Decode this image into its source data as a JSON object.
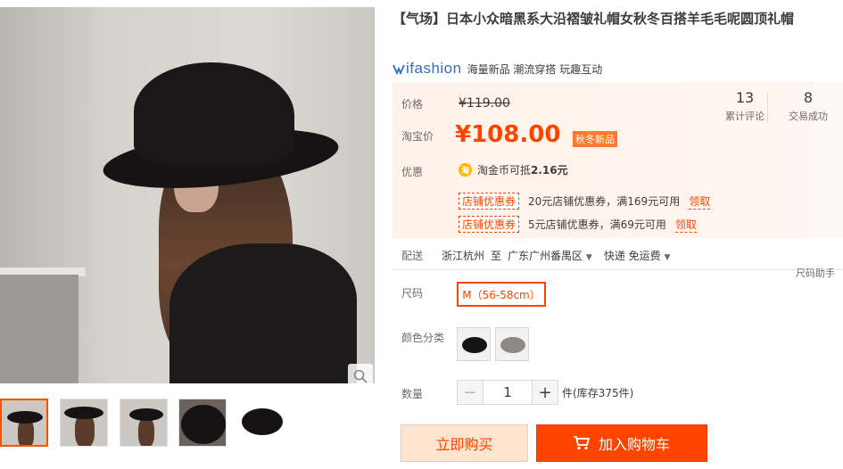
{
  "product": {
    "title": "【气场】日本小众暗黑系大沿褶皱礼帽女秋冬百搭羊毛毛呢圆顶礼帽"
  },
  "brand": {
    "logo_text": "ifashion",
    "tags": "海量新品 潮流穿搭 玩趣互动"
  },
  "price": {
    "label": "价格",
    "original": "¥119.00",
    "taobao_label": "淘宝价",
    "current": "¥108.00",
    "promo_tag": "秋冬新品"
  },
  "stats": [
    {
      "value": "13",
      "label": "累计评论"
    },
    {
      "value": "8",
      "label": "交易成功"
    }
  ],
  "discounts": {
    "label": "优惠",
    "coin_icon": "淘",
    "coin_text": "淘金币可抵",
    "coin_amount": "2.16元",
    "coupons": [
      {
        "tag": "店铺优惠券",
        "text": "20元店铺优惠券，满169元可用",
        "claim": "领取"
      },
      {
        "tag": "店铺优惠券",
        "text": "5元店铺优惠券，满69元可用",
        "claim": "领取"
      }
    ]
  },
  "shipping": {
    "label": "配送",
    "from": "浙江杭州",
    "to_word": "至",
    "to": "广东广州番禺区",
    "method": "快递 免运费"
  },
  "size": {
    "label": "尺码",
    "helper": "尺码助手",
    "selected": "M（56-58cm）"
  },
  "color": {
    "label": "颜色分类"
  },
  "quantity": {
    "label": "数量",
    "minus": "−",
    "value": "1",
    "plus": "+",
    "stock": "件(库存375件)"
  },
  "actions": {
    "buy_now": "立即购买",
    "add_to_cart": "加入购物车"
  },
  "colors": {
    "accent": "#ff4400",
    "price_bg": "#fff2e8",
    "brand_blue": "#2d6fc4"
  },
  "icons": {
    "zoom": "magnifier-icon",
    "cart": "cart-icon",
    "caret": "caret-down-icon"
  }
}
